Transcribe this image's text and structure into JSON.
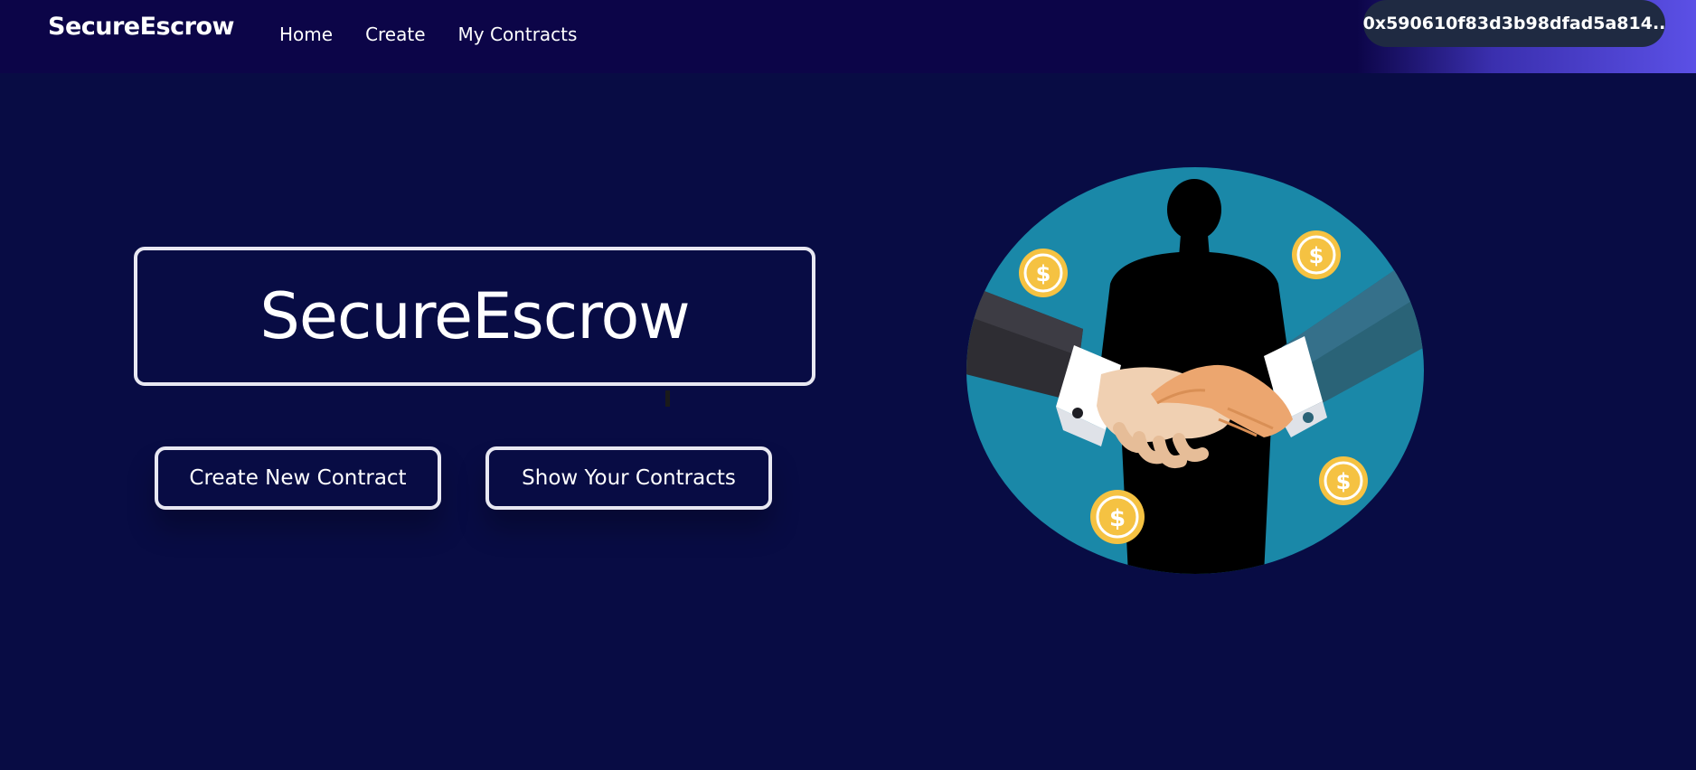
{
  "navbar": {
    "brand": "SecureEscrow",
    "links": [
      {
        "label": "Home"
      },
      {
        "label": "Create"
      },
      {
        "label": "My Contracts"
      }
    ],
    "wallet_address": "0x590610f83d3b98dfad5a814.."
  },
  "hero": {
    "title": "SecureEscrow",
    "create_button": "Create New Contract",
    "show_button": "Show Your Contracts"
  },
  "illustration": {
    "icon": "handshake-illustration",
    "coin_symbol": "$"
  },
  "colors": {
    "background": "#080c44",
    "navbar": "#0c0548",
    "accent": "#5b50e6",
    "illustration_circle": "#1a88a8",
    "coin": "#f5c242"
  }
}
